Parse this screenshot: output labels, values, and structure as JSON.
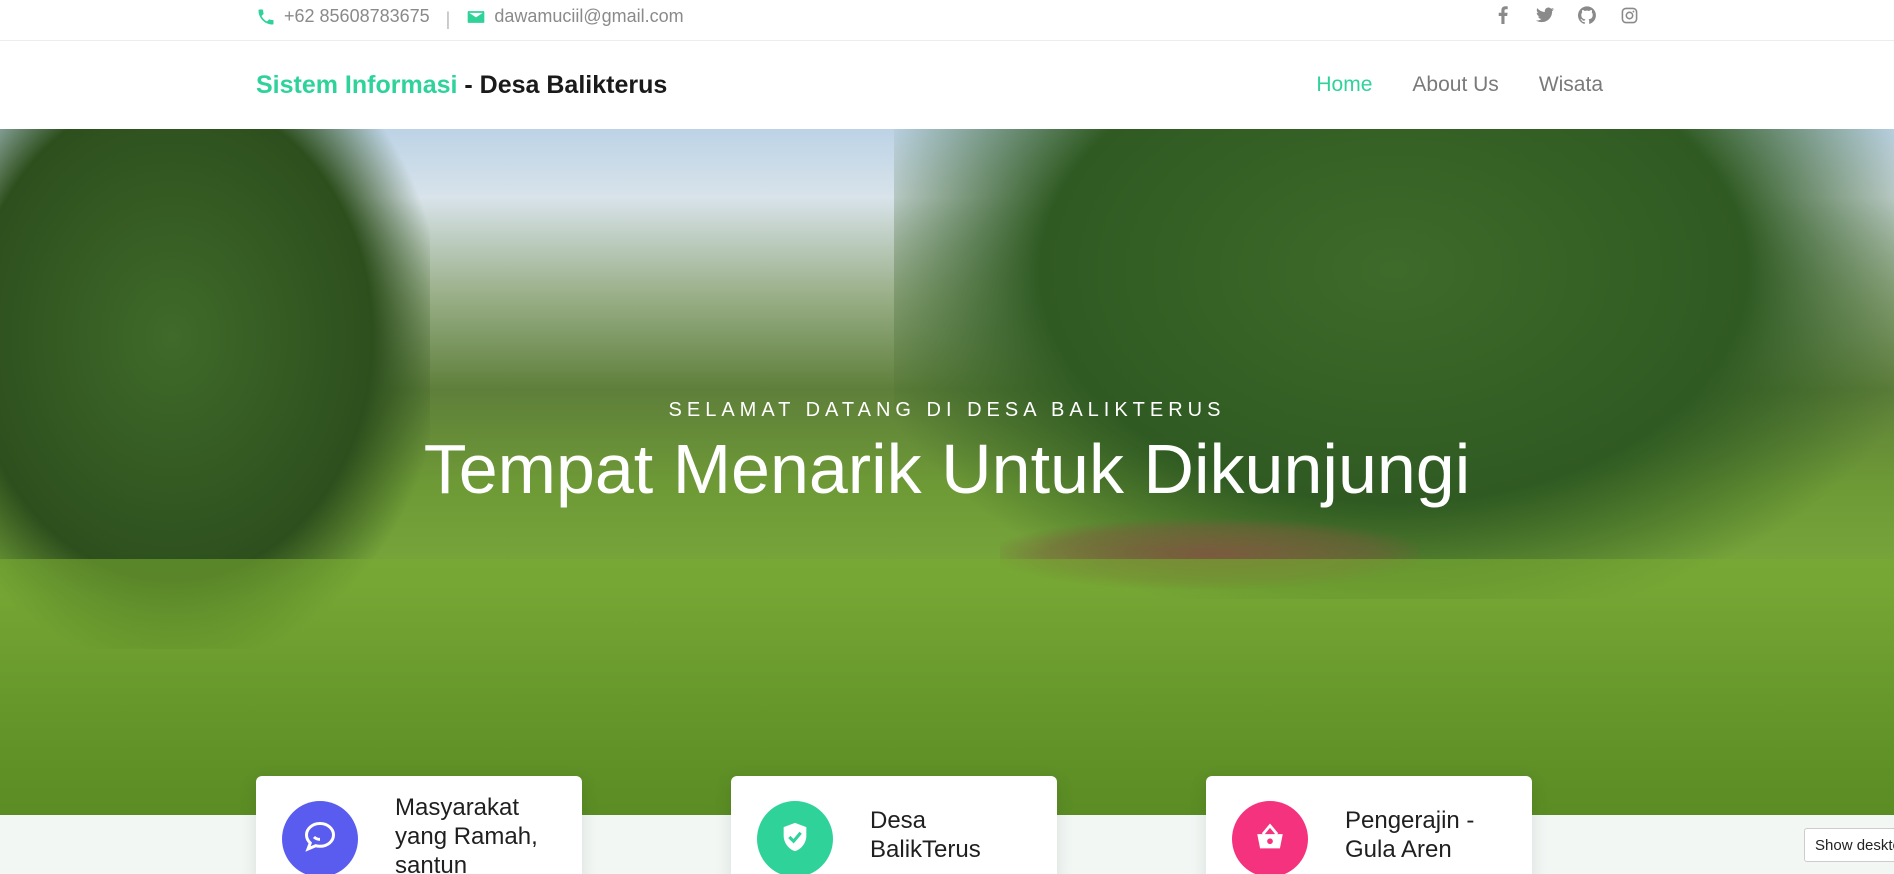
{
  "topbar": {
    "phone": "+62 85608783675",
    "separator": "|",
    "email": "dawamuciil@gmail.com",
    "social_icons": [
      "facebook-icon",
      "twitter-icon",
      "github-icon",
      "instagram-icon"
    ]
  },
  "brand": {
    "accent": "Sistem Informasi",
    "rest": " - Desa Balikterus"
  },
  "nav": {
    "items": [
      {
        "label": "Home",
        "active": true
      },
      {
        "label": "About Us",
        "active": false
      },
      {
        "label": "Wisata",
        "active": false
      }
    ]
  },
  "hero": {
    "subtitle": "Selamat Datang di Desa Balikterus",
    "title": "Tempat Menarik Untuk Dikunjungi"
  },
  "features": [
    {
      "icon": "chat-icon",
      "label": "Masyarakat yang Ramah, santun",
      "color": "#5a5cf0"
    },
    {
      "icon": "shield-check-icon",
      "label": "Desa BalikTerus",
      "color": "#2fd39a"
    },
    {
      "icon": "basket-icon",
      "label": "Pengerajin - Gula Aren",
      "color": "#f4327d"
    }
  ],
  "colors": {
    "accent": "#2fd39a"
  },
  "desktop_button": "Show desktop"
}
